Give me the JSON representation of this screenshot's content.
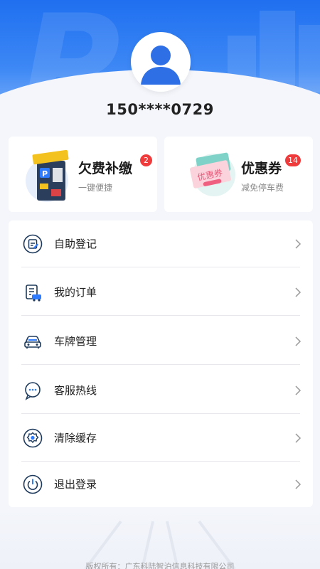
{
  "profile": {
    "phone": "150****0729"
  },
  "cards": {
    "arrears": {
      "title": "欠费补缴",
      "subtitle": "一键便捷",
      "badge": "2"
    },
    "coupons": {
      "title": "优惠券",
      "subtitle": "减免停车费",
      "badge": "14"
    }
  },
  "menu": {
    "items": [
      {
        "label": "自助登记",
        "icon": "clipboard-edit-icon"
      },
      {
        "label": "我的订单",
        "icon": "order-list-icon"
      },
      {
        "label": "车牌管理",
        "icon": "car-icon"
      },
      {
        "label": "客服热线",
        "icon": "chat-headset-icon"
      },
      {
        "label": "清除缓存",
        "icon": "gear-icon"
      },
      {
        "label": "退出登录",
        "icon": "power-icon"
      }
    ]
  },
  "footer": {
    "text": "版权所有：广东科陆智泊信息科技有限公司"
  },
  "colors": {
    "brand": "#1f6ff0",
    "badge": "#ef3b3b",
    "icon_stroke": "#1e3a5c"
  }
}
